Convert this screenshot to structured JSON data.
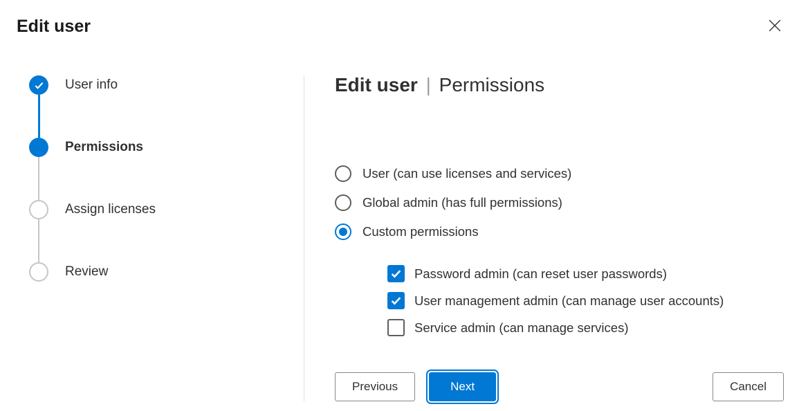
{
  "panel": {
    "title": "Edit user"
  },
  "stepper": {
    "steps": [
      {
        "label": "User info",
        "state": "completed"
      },
      {
        "label": "Permissions",
        "state": "current"
      },
      {
        "label": "Assign licenses",
        "state": "upcoming"
      },
      {
        "label": "Review",
        "state": "upcoming"
      }
    ]
  },
  "main": {
    "heading_bold": "Edit user",
    "heading_sep": "|",
    "heading_rest": "Permissions",
    "radios": [
      {
        "label": "User (can use licenses and services)",
        "selected": false
      },
      {
        "label": "Global admin (has full permissions)",
        "selected": false
      },
      {
        "label": "Custom permissions",
        "selected": true
      }
    ],
    "checkboxes": [
      {
        "label": "Password admin (can reset user passwords)",
        "checked": true
      },
      {
        "label": "User management admin (can manage user accounts)",
        "checked": true
      },
      {
        "label": "Service admin (can manage services)",
        "checked": false
      }
    ]
  },
  "buttons": {
    "previous": "Previous",
    "next": "Next",
    "cancel": "Cancel"
  }
}
